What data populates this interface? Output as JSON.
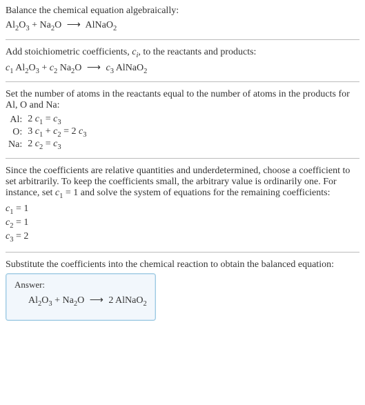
{
  "prompt": {
    "title": "Balance the chemical equation algebraically:",
    "equation_lhs1": "Al",
    "equation_lhs1_sub1": "2",
    "equation_lhs1_mid": "O",
    "equation_lhs1_sub2": "3",
    "plus": " + ",
    "equation_lhs2": "Na",
    "equation_lhs2_sub": "2",
    "equation_lhs2_tail": "O",
    "arrow": "⟶",
    "equation_rhs": "AlNaO",
    "equation_rhs_sub": "2"
  },
  "step1": {
    "text_a": "Add stoichiometric coefficients, ",
    "ci": "c",
    "ci_sub": "i",
    "text_b": ", to the reactants and products:",
    "c1": "c",
    "c1s": "1",
    "c2": "c",
    "c2s": "2",
    "c3": "c",
    "c3s": "3"
  },
  "step2": {
    "text": "Set the number of atoms in the reactants equal to the number of atoms in the products for Al, O and Na:",
    "rows": [
      {
        "el": "Al:",
        "lhs": "2 c₁ = c₃"
      },
      {
        "el": "O:",
        "lhs": "3 c₁ + c₂ = 2 c₃"
      },
      {
        "el": "Na:",
        "lhs": "2 c₂ = c₃"
      }
    ],
    "r0_el": "Al:",
    "r0_eq_a": "2 ",
    "r0_eq_c": "c",
    "r0_eq_cs": "1",
    "r0_eq_mid": " = ",
    "r0_eq_d": "c",
    "r0_eq_ds": "3",
    "r1_el": "O:",
    "r1_eq_a": "3 ",
    "r1_eq_c": "c",
    "r1_eq_cs": "1",
    "r1_eq_mid": " + ",
    "r1_eq_e": "c",
    "r1_eq_es": "2",
    "r1_eq_eq": " = 2 ",
    "r1_eq_f": "c",
    "r1_eq_fs": "3",
    "r2_el": "Na:",
    "r2_eq_a": "2 ",
    "r2_eq_c": "c",
    "r2_eq_cs": "2",
    "r2_eq_mid": " = ",
    "r2_eq_d": "c",
    "r2_eq_ds": "3"
  },
  "step3": {
    "text_a": "Since the coefficients are relative quantities and underdetermined, choose a coefficient to set arbitrarily. To keep the coefficients small, the arbitrary value is ordinarily one. For instance, set ",
    "set_c": "c",
    "set_cs": "1",
    "set_eq": " = 1",
    "text_b": " and solve the system of equations for the remaining coefficients:",
    "l0_c": "c",
    "l0_cs": "1",
    "l0_v": " = 1",
    "l1_c": "c",
    "l1_cs": "2",
    "l1_v": " = 1",
    "l2_c": "c",
    "l2_cs": "3",
    "l2_v": " = 2"
  },
  "step4": {
    "text": "Substitute the coefficients into the chemical reaction to obtain the balanced equation:"
  },
  "answer": {
    "label": "Answer:",
    "two": "2 "
  }
}
